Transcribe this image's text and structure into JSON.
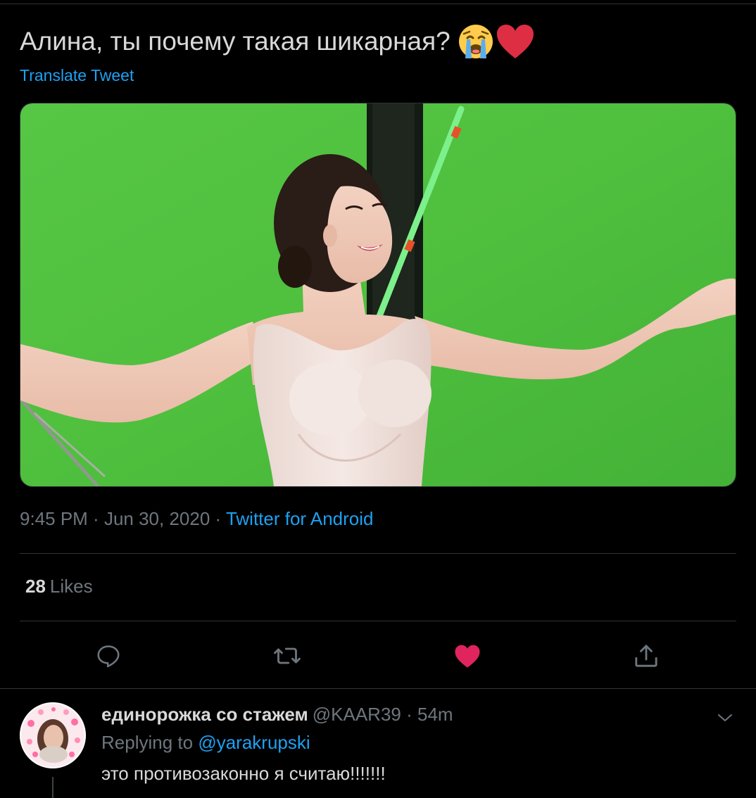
{
  "tweet": {
    "text": "Алина, ты почему такая шикарная?",
    "emojis": [
      "loudly-crying-face",
      "red-heart"
    ],
    "translate_label": "Translate Tweet",
    "time": "9:45 PM",
    "separator": " · ",
    "date": "Jun 30, 2020",
    "source": "Twitter for Android",
    "likes_count": "28",
    "likes_label": "Likes"
  },
  "actions": {
    "icons": [
      "reply-icon",
      "retweet-icon",
      "like-icon",
      "share-icon"
    ],
    "liked": true
  },
  "reply": {
    "display_name": "единорожка со стажем",
    "handle": "@KAAR39",
    "separator": "·",
    "time": "54m",
    "replying_prefix": "Replying to ",
    "replying_to": "@yarakrupski",
    "text": "это противозаконно я считаю!!!!!!!"
  },
  "colors": {
    "background": "#000000",
    "text": "#d9d9d9",
    "muted": "#6e767d",
    "accent": "#1da1f2",
    "like": "#e0245e",
    "divider": "#2f3336"
  }
}
